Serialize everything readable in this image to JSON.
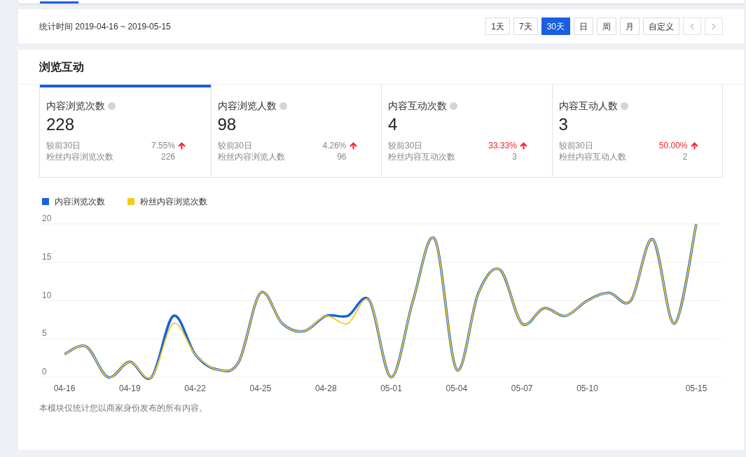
{
  "period": {
    "label": "统计时间 2019-04-16 ~ 2019-05-15"
  },
  "range_buttons": [
    {
      "label": "1天",
      "selected": false
    },
    {
      "label": "7天",
      "selected": false
    },
    {
      "label": "30天",
      "selected": true
    },
    {
      "label": "日",
      "selected": false
    },
    {
      "label": "周",
      "selected": false
    },
    {
      "label": "月",
      "selected": false
    },
    {
      "label": "自定义",
      "selected": false
    }
  ],
  "section": {
    "title": "浏览互动",
    "metrics": [
      {
        "title": "内容浏览次数",
        "value": "228",
        "compare_label": "较前30日",
        "change": "7.55%",
        "color": "#888888",
        "fans_label": "粉丝内容浏览次数",
        "fans_value": "226",
        "selected": true
      },
      {
        "title": "内容浏览人数",
        "value": "98",
        "compare_label": "较前30日",
        "change": "4.26%",
        "color": "#888888",
        "fans_label": "粉丝内容浏览人数",
        "fans_value": "96",
        "selected": false
      },
      {
        "title": "内容互动次数",
        "value": "4",
        "compare_label": "较前30日",
        "change": "33.33%",
        "color": "#f5222d",
        "fans_label": "粉丝内容互动次数",
        "fans_value": "3",
        "selected": false
      },
      {
        "title": "内容互动人数",
        "value": "3",
        "compare_label": "较前30日",
        "change": "50.00%",
        "color": "#f5222d",
        "fans_label": "粉丝内容互动人数",
        "fans_value": "2",
        "selected": false
      }
    ],
    "chart_data": {
      "type": "line",
      "categories": [
        "04-16",
        null,
        null,
        "04-19",
        null,
        null,
        "04-22",
        null,
        null,
        "04-25",
        null,
        null,
        "04-28",
        null,
        null,
        "05-01",
        null,
        null,
        "05-04",
        null,
        null,
        "05-07",
        null,
        null,
        "05-10",
        null,
        null,
        null,
        null,
        "05-15"
      ],
      "ylim": [
        0,
        20
      ],
      "yticks": [
        0,
        5,
        10,
        15,
        20
      ],
      "grid": true,
      "legend": true,
      "series": [
        {
          "name": "内容浏览次数",
          "color": "#1a5fe0",
          "values": [
            3,
            4,
            0,
            2,
            0,
            8,
            3,
            1,
            2,
            11,
            7,
            6,
            8,
            8,
            10,
            0,
            10,
            18,
            1,
            11,
            14,
            7,
            9,
            8,
            10,
            11,
            10,
            18,
            7,
            20
          ]
        },
        {
          "name": "粉丝内容浏览次数",
          "color": "#f0cc1c",
          "values": [
            3,
            4,
            0,
            2,
            0,
            7,
            3,
            1,
            2,
            11,
            7,
            6,
            8,
            7,
            10,
            0,
            10,
            18,
            1,
            11,
            14,
            7,
            9,
            8,
            10,
            11,
            10,
            18,
            7,
            20
          ]
        }
      ]
    },
    "footnote": "本模块仅统计您以商家身份发布的所有内容。"
  }
}
